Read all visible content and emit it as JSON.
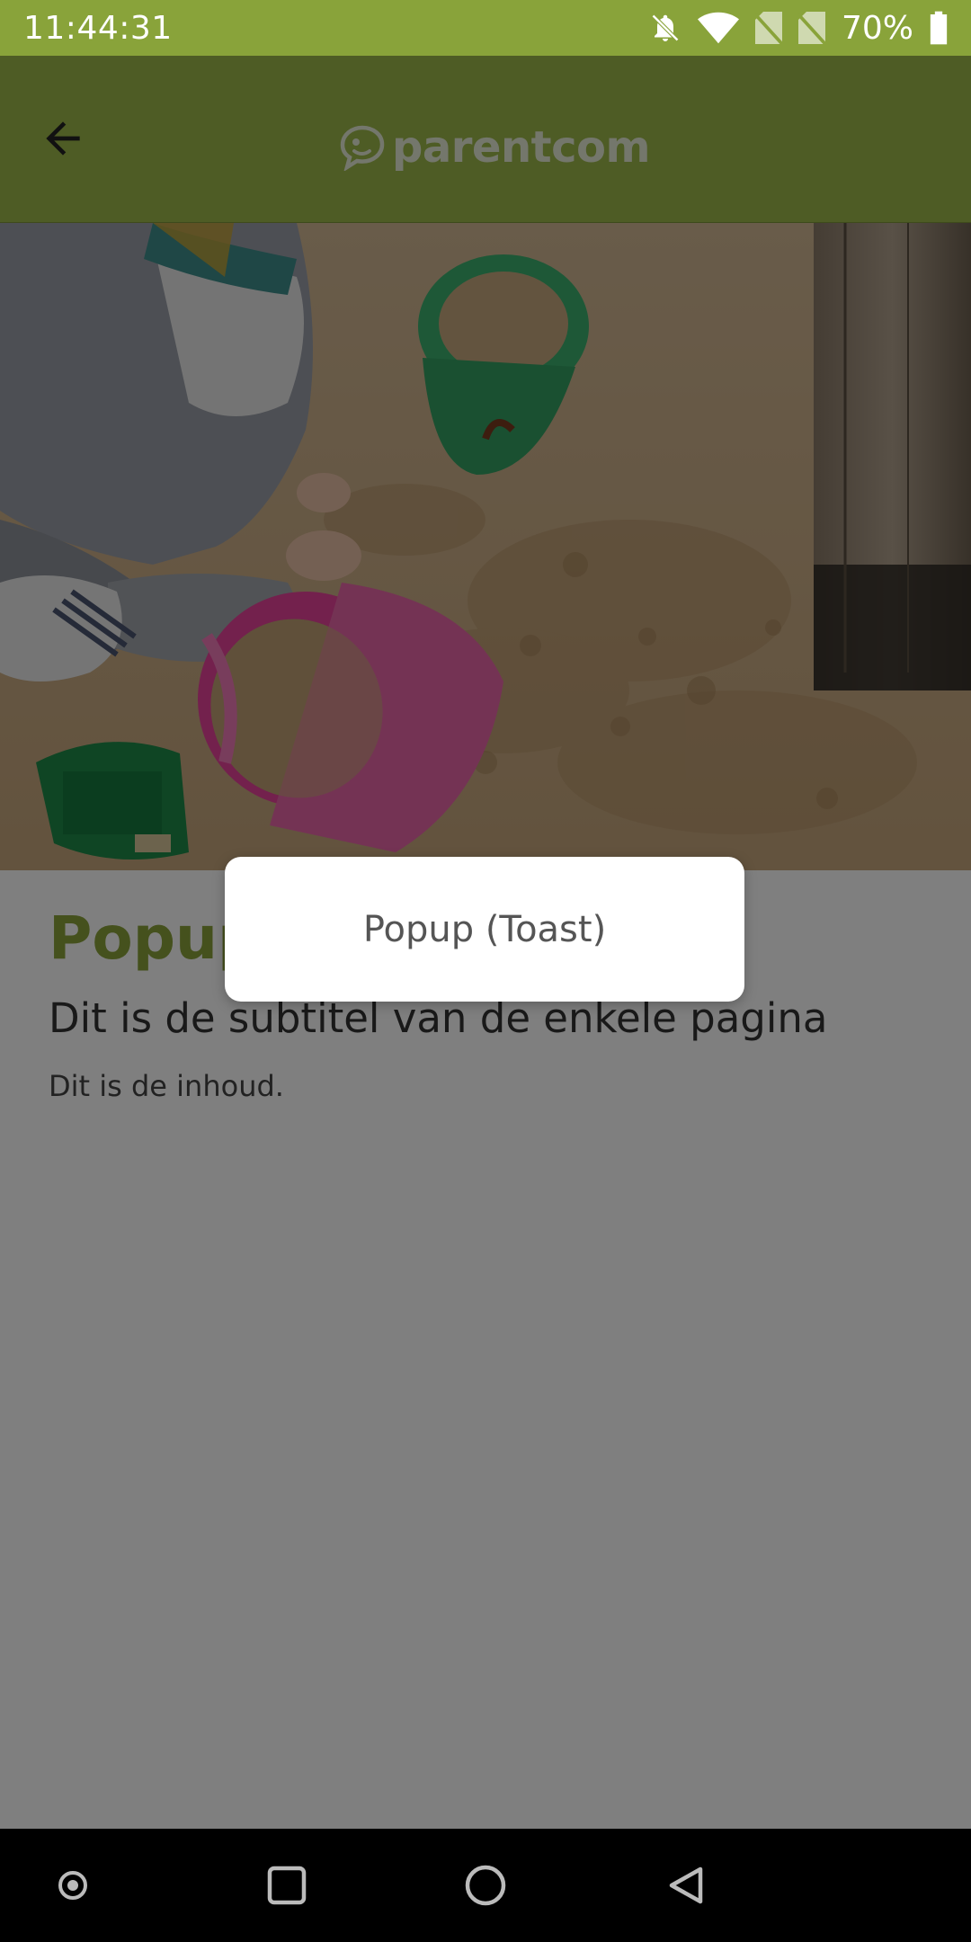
{
  "status_bar": {
    "time": "11:44:31",
    "battery": "70%",
    "icons": [
      "notifications-off-icon",
      "wifi-icon",
      "no-sim-icon",
      "no-sim-icon",
      "battery-icon"
    ]
  },
  "app_bar": {
    "logo_text": "parentcom",
    "back_icon": "arrow-back-icon",
    "color": "#9cb84a"
  },
  "hero": {
    "description_icon": "hero-image"
  },
  "page": {
    "title": "Popup",
    "subtitle": "Dit is de subtitel van de enkele pagina",
    "body": "Dit is de inhoud."
  },
  "toast": {
    "text": "Popup (Toast)"
  },
  "nav_bar": {
    "icons": [
      "dot-icon",
      "recents-icon",
      "home-icon",
      "back-triangle-icon"
    ]
  },
  "colors": {
    "accent": "#8aa23a",
    "status_bar": "#89a33a"
  }
}
